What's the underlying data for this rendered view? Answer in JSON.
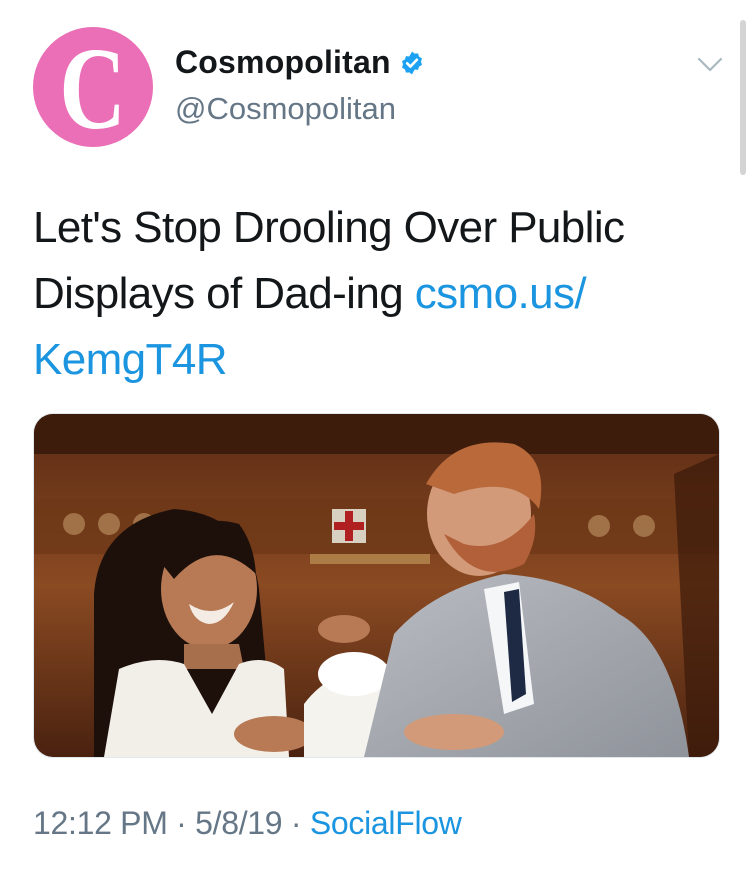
{
  "account": {
    "display_name": "Cosmopolitan",
    "handle": "@Cosmopolitan",
    "avatar_letter": "C",
    "avatar_color": "#ea6fb6",
    "verified": true
  },
  "tweet": {
    "text": "Let's Stop Drooling Over Public Displays of Dad-ing ",
    "link_text": "csmo.us/​KemgT4R",
    "media_alt": "Photo of a smiling couple holding a newborn baby wrapped in a white blanket"
  },
  "meta": {
    "time": "12:12 PM",
    "separator": " · ",
    "date": "5/8/19",
    "source": "SocialFlow"
  },
  "colors": {
    "link": "#1b95e0",
    "secondary_text": "#657786",
    "verified_badge": "#1da1f2"
  }
}
